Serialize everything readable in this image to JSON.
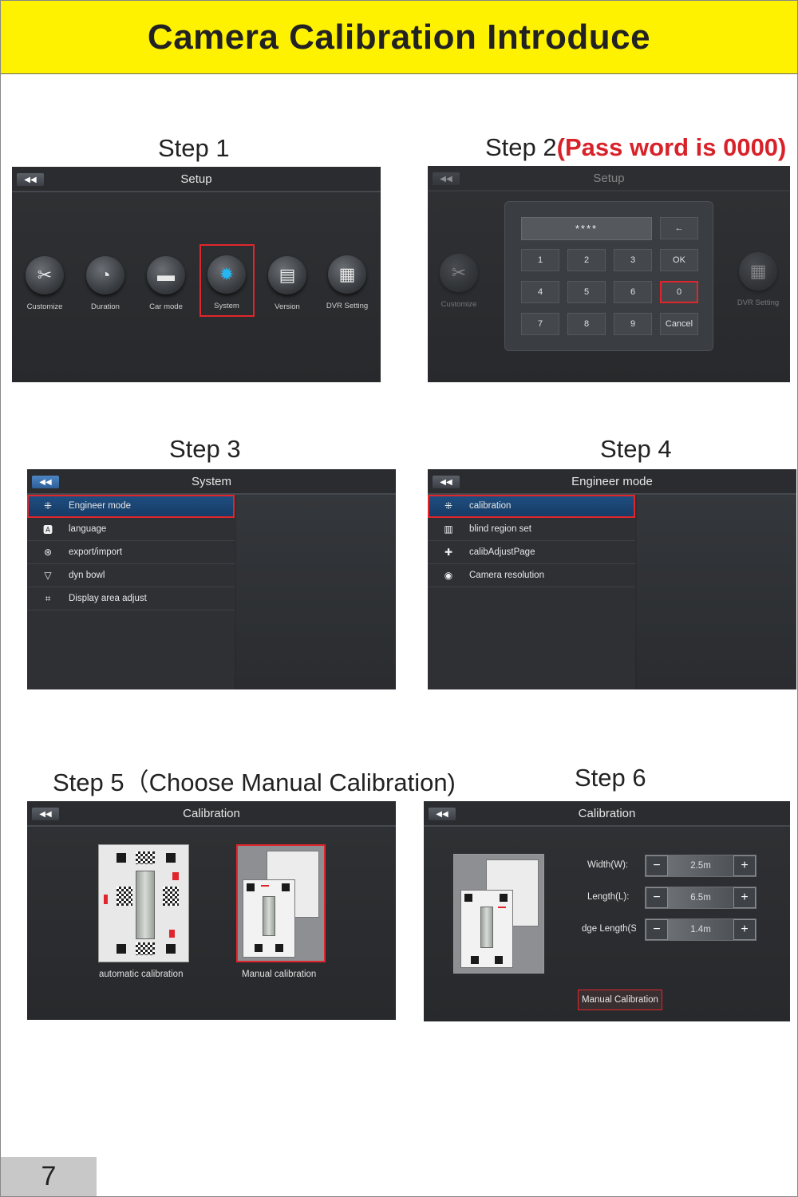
{
  "title": "Camera Calibration Introduce",
  "page_number": "7",
  "step1": {
    "heading": "Step 1",
    "screen_title": "Setup",
    "items": [
      {
        "label": "Customize",
        "icon": "tools-icon"
      },
      {
        "label": "Duration",
        "icon": "stopwatch-icon"
      },
      {
        "label": "Car mode",
        "icon": "car-icon"
      },
      {
        "label": "System",
        "icon": "gear-icon"
      },
      {
        "label": "Version",
        "icon": "folder-icon"
      },
      {
        "label": "DVR Setting",
        "icon": "clapper-icon"
      }
    ],
    "selected": "System"
  },
  "step2": {
    "heading": "Step  2",
    "note": "(Pass word is 0000)",
    "screen_title": "Setup",
    "password_display": "****",
    "backspace": "←",
    "keys": [
      "1",
      "2",
      "3",
      "OK",
      "4",
      "5",
      "6",
      "0",
      "7",
      "8",
      "9",
      "Cancel"
    ],
    "highlighted_key": "0",
    "bg_items": {
      "left": "Customize",
      "right": "DVR Setting"
    }
  },
  "step3": {
    "heading": "Step 3",
    "screen_title": "System",
    "items": [
      {
        "label": "Engineer mode",
        "icon": "engineer-icon"
      },
      {
        "label": "language",
        "icon": "language-icon"
      },
      {
        "label": "export/import",
        "icon": "export-icon"
      },
      {
        "label": "dyn bowl",
        "icon": "bowl-icon"
      },
      {
        "label": "Display area adjust",
        "icon": "crop-icon"
      }
    ],
    "selected": "Engineer mode"
  },
  "step4": {
    "heading": "Step 4",
    "screen_title": "Engineer mode",
    "items": [
      {
        "label": "calibration",
        "icon": "calibration-icon"
      },
      {
        "label": "blind region set",
        "icon": "region-icon"
      },
      {
        "label": "calibAdjustPage",
        "icon": "puzzle-icon"
      },
      {
        "label": "Camera resolution",
        "icon": "camera-icon"
      }
    ],
    "selected": "calibration"
  },
  "step5": {
    "heading": "Step 5（Choose Manual Calibration)",
    "screen_title": "Calibration",
    "options": [
      {
        "label": "automatic calibration"
      },
      {
        "label": "Manual calibration"
      }
    ],
    "selected": "Manual calibration"
  },
  "step6": {
    "heading": "Step 6",
    "screen_title": "Calibration",
    "fields": [
      {
        "label": "Width(W):",
        "value": "2.5m"
      },
      {
        "label": "Length(L):",
        "value": "6.5m"
      },
      {
        "label": "dge Length(S",
        "value": "1.4m"
      }
    ],
    "minus": "−",
    "plus": "+",
    "button": "Manual Calibration"
  },
  "colors": {
    "banner": "#fff200",
    "highlight": "#e0262c",
    "screen": "#2b2d30",
    "accent_cyan": "#27b6f0"
  }
}
